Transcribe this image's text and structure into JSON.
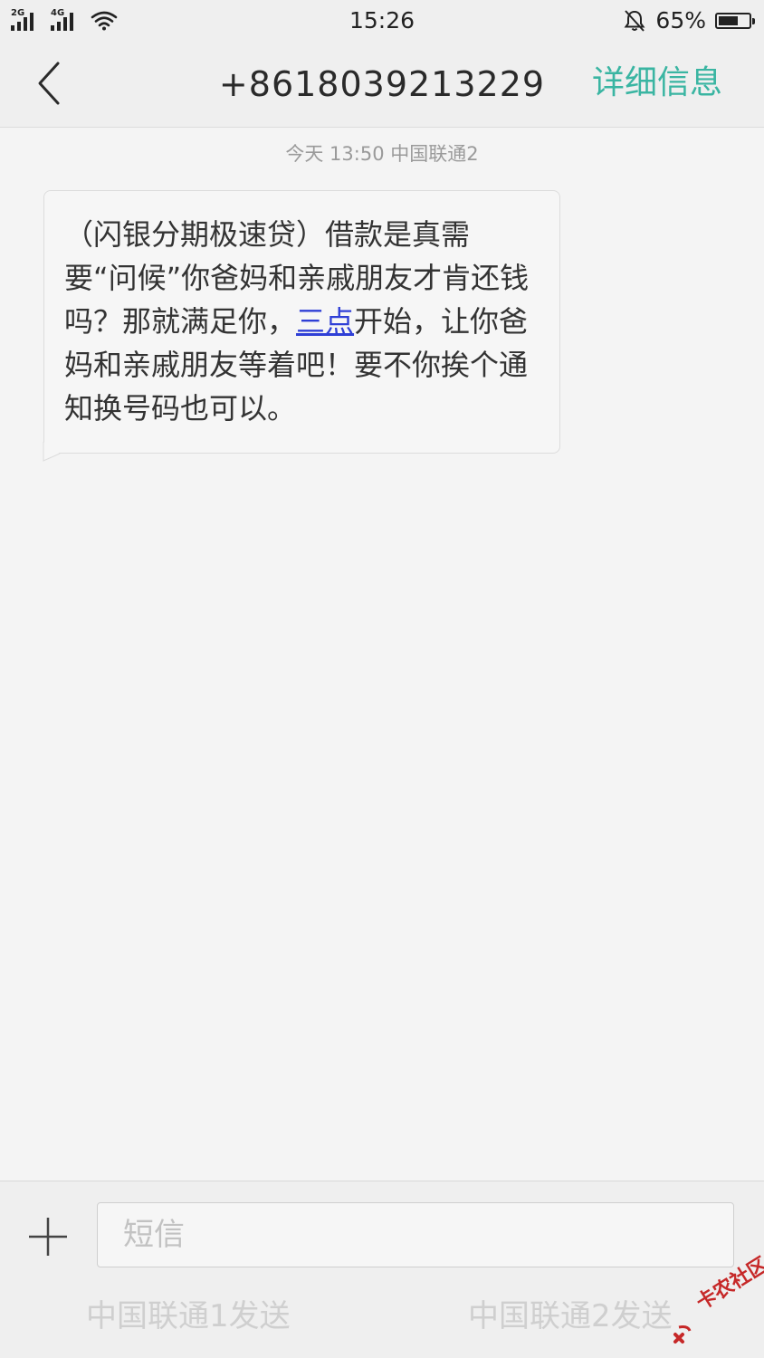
{
  "status_bar": {
    "network_1": "2G",
    "network_2": "4G",
    "time": "15:26",
    "battery_percent": "65%",
    "battery_level": 0.65,
    "icons": [
      "signal-icon",
      "wifi-icon",
      "bell-off-icon",
      "battery-icon"
    ]
  },
  "header": {
    "back_icon": "chevron-left-icon",
    "title": "+8618039213229",
    "details_label": "详细信息",
    "accent_color": "#3ab5a2"
  },
  "conversation": {
    "date_label": "今天",
    "time_label": "13:50",
    "carrier_label": "中国联通2",
    "message": {
      "part_1": "（闪银分期极速贷）借款是真需要“问候”你爸妈和亲戚朋友才肯还钱吗？那就满足你，",
      "link_text": "三点",
      "part_2": "开始，让你爸妈和亲戚朋友等着吧！要不你挨个通知换号码也可以。"
    }
  },
  "compose": {
    "plus_icon": "plus-icon",
    "placeholder": "短信",
    "send_sim1_label": "中国联通1发送",
    "send_sim2_label": "中国联通2发送"
  },
  "watermark": {
    "text": "卡农社区",
    "color": "#c62828"
  }
}
